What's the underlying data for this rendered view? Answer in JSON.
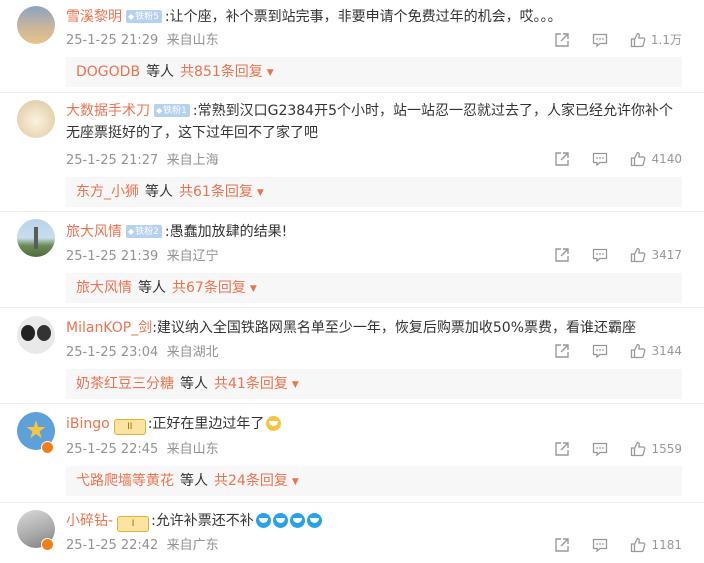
{
  "comments": [
    {
      "username": "雪溪黎明",
      "badge": "铁粉5",
      "text": ":让个座，补个票到站完事，非要申请个免费过年的机会，哎。。。",
      "time": "25-1-25 21:29",
      "location": "来自山东",
      "likes": "1.1万",
      "reply_user": "DOGODB",
      "reply_mid": "等人",
      "reply_count": "共851条回复"
    },
    {
      "username": "大数据手术刀",
      "badge": "铁粉1",
      "text": ":常熟到汉口G2384开5个小时，站一站忍一忍就过去了，人家已经允许你补个无座票挺好的了，这下过年回不了家了吧",
      "time": "25-1-25 21:27",
      "location": "来自上海",
      "likes": "4140",
      "reply_user": "东方_小狮",
      "reply_mid": "等人",
      "reply_count": "共61条回复"
    },
    {
      "username": "旅大风情",
      "badge": "铁粉2",
      "text": ":愚蠢加放肆的结果!",
      "time": "25-1-25 21:39",
      "location": "来自辽宁",
      "likes": "3417",
      "reply_user": "旅大风情",
      "reply_mid": "等人",
      "reply_count": "共67条回复"
    },
    {
      "username": "MilanKOP_剑",
      "text": ":建议纳入全国铁路网黑名单至少一年，恢复后购票加收50%票费，看谁还霸座",
      "time": "25-1-25 23:04",
      "location": "来自湖北",
      "likes": "3144",
      "reply_user": "奶茶红豆三分糖",
      "reply_mid": "等人",
      "reply_count": "共41条回复"
    },
    {
      "username": "iBingo",
      "crown": "II",
      "text": ":正好在里边过年了",
      "time": "25-1-25 22:45",
      "location": "来自山东",
      "likes": "1559",
      "reply_user": "弋路爬墙等黄花",
      "reply_mid": "等人",
      "reply_count": "共24条回复"
    },
    {
      "username": "小碎钻-",
      "crown": "I",
      "text": ":允许补票还不补",
      "time": "25-1-25 22:42",
      "location": "来自广东",
      "likes": "1181"
    }
  ]
}
